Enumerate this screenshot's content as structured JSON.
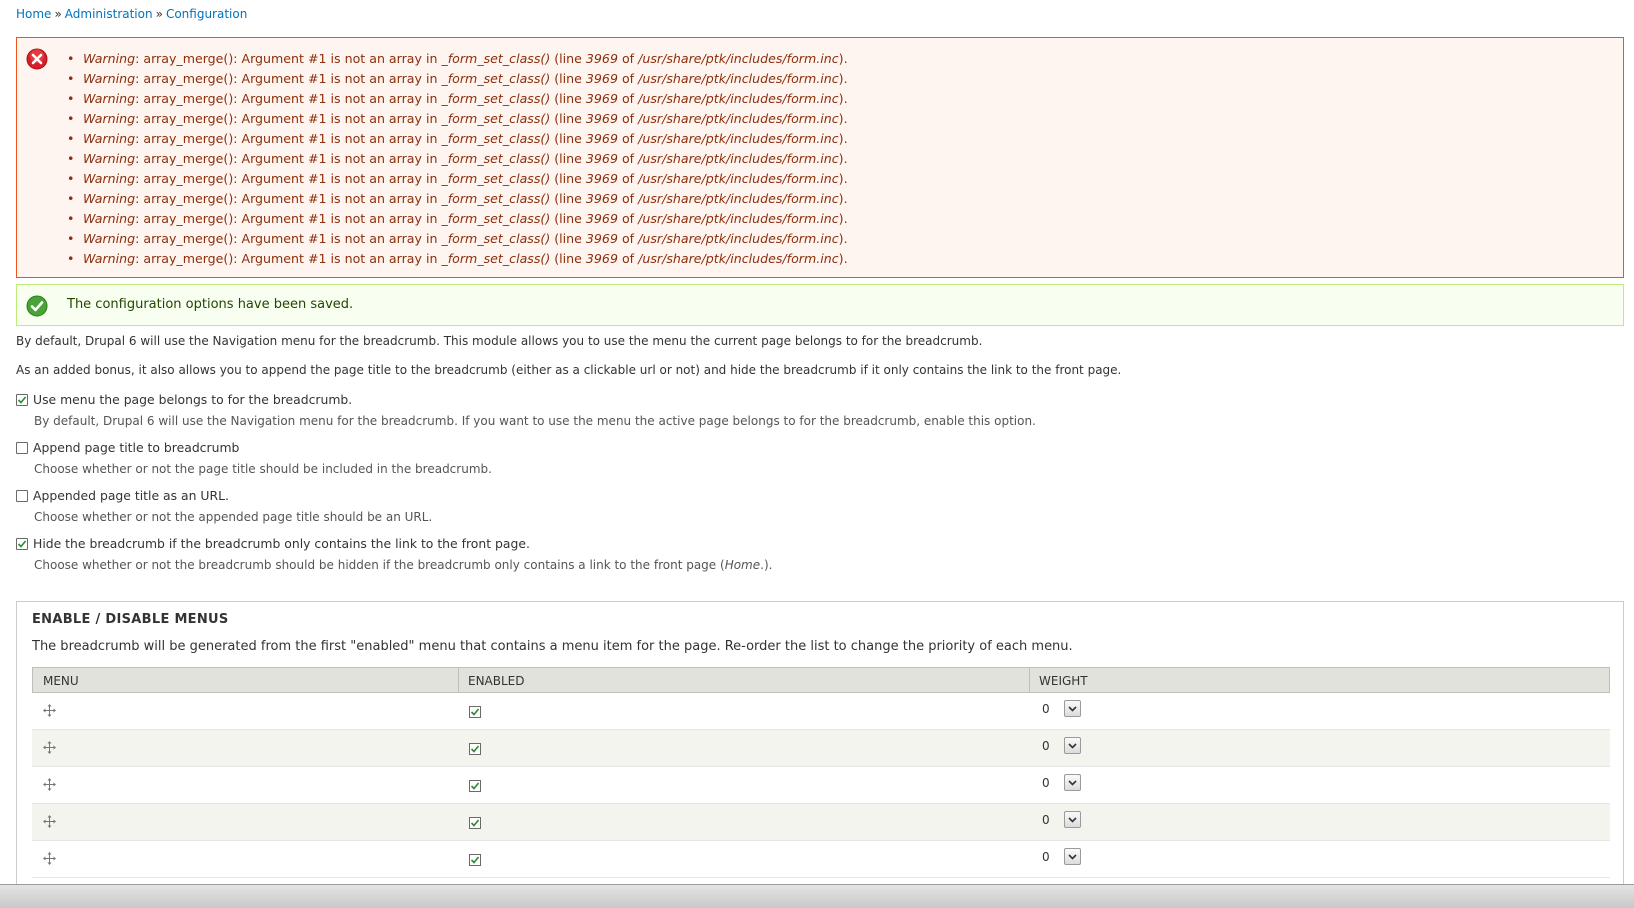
{
  "breadcrumb": {
    "items": [
      "Home",
      "Administration",
      "Configuration"
    ],
    "separator": "»"
  },
  "error_messages": {
    "items": [
      {
        "prefix": "Warning",
        "text1": ": array_merge(): Argument #1 is not an array in ",
        "func": "_form_set_class()",
        "text2": " (line ",
        "line": "3969",
        "text3": " of ",
        "file": "/usr/share/ptk/includes/form.inc",
        "text4": ")."
      },
      {
        "prefix": "Warning",
        "text1": ": array_merge(): Argument #1 is not an array in ",
        "func": "_form_set_class()",
        "text2": " (line ",
        "line": "3969",
        "text3": " of ",
        "file": "/usr/share/ptk/includes/form.inc",
        "text4": ")."
      },
      {
        "prefix": "Warning",
        "text1": ": array_merge(): Argument #1 is not an array in ",
        "func": "_form_set_class()",
        "text2": " (line ",
        "line": "3969",
        "text3": " of ",
        "file": "/usr/share/ptk/includes/form.inc",
        "text4": ")."
      },
      {
        "prefix": "Warning",
        "text1": ": array_merge(): Argument #1 is not an array in ",
        "func": "_form_set_class()",
        "text2": " (line ",
        "line": "3969",
        "text3": " of ",
        "file": "/usr/share/ptk/includes/form.inc",
        "text4": ")."
      },
      {
        "prefix": "Warning",
        "text1": ": array_merge(): Argument #1 is not an array in ",
        "func": "_form_set_class()",
        "text2": " (line ",
        "line": "3969",
        "text3": " of ",
        "file": "/usr/share/ptk/includes/form.inc",
        "text4": ")."
      },
      {
        "prefix": "Warning",
        "text1": ": array_merge(): Argument #1 is not an array in ",
        "func": "_form_set_class()",
        "text2": " (line ",
        "line": "3969",
        "text3": " of ",
        "file": "/usr/share/ptk/includes/form.inc",
        "text4": ")."
      },
      {
        "prefix": "Warning",
        "text1": ": array_merge(): Argument #1 is not an array in ",
        "func": "_form_set_class()",
        "text2": " (line ",
        "line": "3969",
        "text3": " of ",
        "file": "/usr/share/ptk/includes/form.inc",
        "text4": ")."
      },
      {
        "prefix": "Warning",
        "text1": ": array_merge(): Argument #1 is not an array in ",
        "func": "_form_set_class()",
        "text2": " (line ",
        "line": "3969",
        "text3": " of ",
        "file": "/usr/share/ptk/includes/form.inc",
        "text4": ")."
      },
      {
        "prefix": "Warning",
        "text1": ": array_merge(): Argument #1 is not an array in ",
        "func": "_form_set_class()",
        "text2": " (line ",
        "line": "3969",
        "text3": " of ",
        "file": "/usr/share/ptk/includes/form.inc",
        "text4": ")."
      },
      {
        "prefix": "Warning",
        "text1": ": array_merge(): Argument #1 is not an array in ",
        "func": "_form_set_class()",
        "text2": " (line ",
        "line": "3969",
        "text3": " of ",
        "file": "/usr/share/ptk/includes/form.inc",
        "text4": ")."
      },
      {
        "prefix": "Warning",
        "text1": ": array_merge(): Argument #1 is not an array in ",
        "func": "_form_set_class()",
        "text2": " (line ",
        "line": "3969",
        "text3": " of ",
        "file": "/usr/share/ptk/includes/form.inc",
        "text4": ")."
      }
    ]
  },
  "status_message": "The configuration options have been saved.",
  "intro": {
    "p1": "By default, Drupal 6 will use the Navigation menu for the breadcrumb. This module allows you to use the menu the current page belongs to for the breadcrumb.",
    "p2": "As an added bonus, it also allows you to append the page title to the breadcrumb (either as a clickable url or not) and hide the breadcrumb if it only contains the link to the front page."
  },
  "options": [
    {
      "label": "Use menu the page belongs to for the breadcrumb.",
      "checked": true,
      "description": "By default, Drupal 6 will use the Navigation menu for the breadcrumb. If you want to use the menu the active page belongs to for the breadcrumb, enable this option."
    },
    {
      "label": "Append page title to breadcrumb",
      "checked": false,
      "description": "Choose whether or not the page title should be included in the breadcrumb."
    },
    {
      "label": "Appended page title as an URL.",
      "checked": false,
      "description": "Choose whether or not the appended page title should be an URL."
    },
    {
      "label": "Hide the breadcrumb if the breadcrumb only contains the link to the front page.",
      "checked": true,
      "description_pre": "Choose whether or not the breadcrumb should be hidden if the breadcrumb only contains a link to the front page (",
      "description_em": "Home",
      "description_post": ".)."
    }
  ],
  "menus_fieldset": {
    "legend": "ENABLE / DISABLE MENUS",
    "description": "The breadcrumb will be generated from the first \"enabled\" menu that contains a menu item for the page. Re-order the list to change the priority of each menu.",
    "columns": [
      "MENU",
      "ENABLED",
      "WEIGHT"
    ],
    "rows": [
      {
        "enabled": true,
        "weight": "0"
      },
      {
        "enabled": true,
        "weight": "0"
      },
      {
        "enabled": true,
        "weight": "0"
      },
      {
        "enabled": true,
        "weight": "0"
      },
      {
        "enabled": true,
        "weight": "0"
      }
    ]
  },
  "colors": {
    "link": "#0074bd",
    "error_bg": "#fef5f1",
    "error_border": "#ed541d",
    "error_text": "#8c2e0b",
    "status_bg": "#f8fff0",
    "status_border": "#bbee77",
    "status_icon": "#4aa336",
    "checkmark": "#2f8a2f"
  },
  "icons": {
    "error": "error-x-icon",
    "status": "check-circle-icon",
    "drag": "drag-handle-icon",
    "checkbox": "checkmark-icon",
    "select": "chevron-down-icon"
  }
}
